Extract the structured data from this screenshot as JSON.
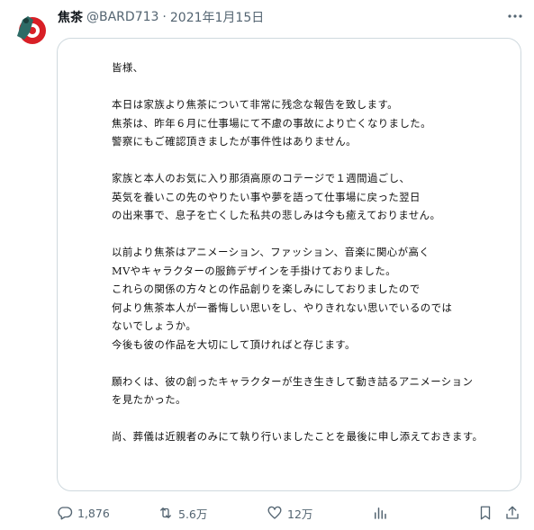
{
  "tweet": {
    "display_name": "焦茶",
    "handle": "@BARD713",
    "separator": "·",
    "date": "2021年1月15日"
  },
  "letter": {
    "salutation": "皆様、",
    "lines_1": [
      "本日は家族より焦茶について非常に残念な報告を致します。",
      "焦茶は、昨年６月に仕事場にて不慮の事故により亡くなりました。",
      "警察にもご確認頂きましたが事件性はありません。"
    ],
    "lines_2": [
      "家族と本人のお気に入り那須高原のコテージで１週間過ごし、",
      "英気を養いこの先のやりたい事や夢を語って仕事場に戻った翌日",
      "の出来事で、息子を亡くした私共の悲しみは今も癒えておりません。"
    ],
    "lines_3": [
      "以前より焦茶はアニメーション、ファッション、音楽に関心が高く",
      "MVやキャラクターの服飾デザインを手掛けておりました。",
      "これらの関係の方々との作品創りを楽しみにしておりましたので",
      "何より焦茶本人が一番悔しい思いをし、やりきれない思いでいるのでは",
      "ないでしょうか。",
      "今後も彼の作品を大切にして頂ければと存じます。"
    ],
    "lines_4": [
      "願わくは、彼の創ったキャラクターが生き生きして動き詰るアニメーション",
      "を見たかった。"
    ],
    "lines_5": [
      "尚、葬儀は近親者のみにて執り行いましたことを最後に申し添えておきます。"
    ]
  },
  "actions": {
    "replies": "1,876",
    "retweets": "5.6万",
    "likes": "12万"
  },
  "icons": {
    "avatar": "avatar-red-circle-icon",
    "more": "more-dots-icon",
    "reply": "reply-bubble-icon",
    "retweet": "retweet-arrows-icon",
    "like": "heart-icon",
    "views": "analytics-bars-icon",
    "bookmark": "bookmark-icon",
    "share": "share-upload-icon"
  },
  "colors": {
    "muted_text": "#536471",
    "border": "#cfd9de",
    "avatar_red": "#d81f26",
    "avatar_teal": "#2d6b66"
  }
}
